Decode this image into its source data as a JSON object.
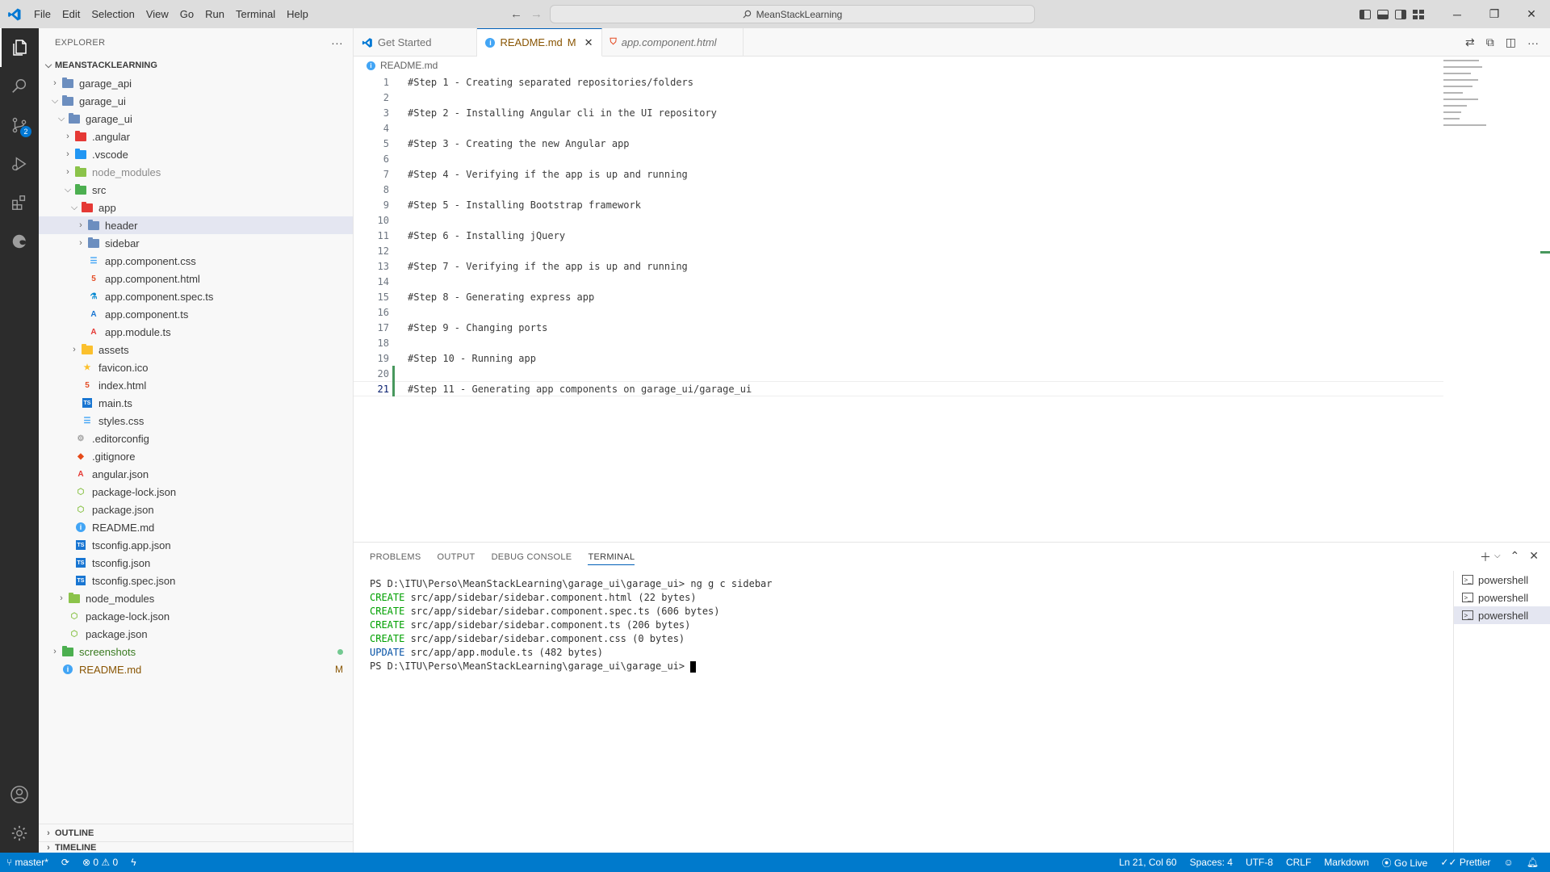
{
  "titlebar": {
    "menu": [
      "File",
      "Edit",
      "Selection",
      "View",
      "Go",
      "Run",
      "Terminal",
      "Help"
    ],
    "search_text": "MeanStackLearning"
  },
  "activity": {
    "scm_badge": "2"
  },
  "explorer": {
    "title": "EXPLORER",
    "root": "MEANSTACKLEARNING",
    "items": [
      {
        "label": "garage_api",
        "depth": 1,
        "kind": "folder",
        "open": false,
        "color": "#6c8ebf"
      },
      {
        "label": "garage_ui",
        "depth": 1,
        "kind": "folder",
        "open": true,
        "color": "#6c8ebf"
      },
      {
        "label": "garage_ui",
        "depth": 2,
        "kind": "folder",
        "open": true,
        "color": "#6c8ebf"
      },
      {
        "label": ".angular",
        "depth": 3,
        "kind": "folder",
        "open": false,
        "color": "#e53935"
      },
      {
        "label": ".vscode",
        "depth": 3,
        "kind": "folder",
        "open": false,
        "color": "#2196f3"
      },
      {
        "label": "node_modules",
        "depth": 3,
        "kind": "folder",
        "open": false,
        "color": "#8bc34a",
        "dim": true
      },
      {
        "label": "src",
        "depth": 3,
        "kind": "folder",
        "open": true,
        "color": "#4caf50"
      },
      {
        "label": "app",
        "depth": 4,
        "kind": "folder",
        "open": true,
        "color": "#e53935"
      },
      {
        "label": "header",
        "depth": 5,
        "kind": "folder",
        "open": false,
        "color": "#6c8ebf",
        "selected": true
      },
      {
        "label": "sidebar",
        "depth": 5,
        "kind": "folder",
        "open": false,
        "color": "#6c8ebf"
      },
      {
        "label": "app.component.css",
        "depth": 5,
        "kind": "file",
        "icon": "css-file-icon",
        "glyph": "☰",
        "color": "#42a5f5"
      },
      {
        "label": "app.component.html",
        "depth": 5,
        "kind": "file",
        "icon": "html-file-icon",
        "glyph": "5",
        "color": "#e44d26"
      },
      {
        "label": "app.component.spec.ts",
        "depth": 5,
        "kind": "file",
        "icon": "test-file-icon",
        "glyph": "⚗",
        "color": "#0288d1"
      },
      {
        "label": "app.component.ts",
        "depth": 5,
        "kind": "file",
        "icon": "angular-component-icon",
        "glyph": "A",
        "color": "#1976d2"
      },
      {
        "label": "app.module.ts",
        "depth": 5,
        "kind": "file",
        "icon": "angular-module-icon",
        "glyph": "A",
        "color": "#e53935"
      },
      {
        "label": "assets",
        "depth": 4,
        "kind": "folder",
        "open": false,
        "color": "#fbc02d"
      },
      {
        "label": "favicon.ico",
        "depth": 4,
        "kind": "file",
        "icon": "favicon-icon",
        "glyph": "★",
        "color": "#fbc02d"
      },
      {
        "label": "index.html",
        "depth": 4,
        "kind": "file",
        "icon": "html-file-icon",
        "glyph": "5",
        "color": "#e44d26"
      },
      {
        "label": "main.ts",
        "depth": 4,
        "kind": "file",
        "icon": "ts-file-icon",
        "glyph": "TS",
        "color": "#1976d2"
      },
      {
        "label": "styles.css",
        "depth": 4,
        "kind": "file",
        "icon": "css-file-icon",
        "glyph": "☰",
        "color": "#42a5f5"
      },
      {
        "label": ".editorconfig",
        "depth": 3,
        "kind": "file",
        "icon": "editorconfig-icon",
        "glyph": "⚙",
        "color": "#9e9e9e"
      },
      {
        "label": ".gitignore",
        "depth": 3,
        "kind": "file",
        "icon": "git-icon",
        "glyph": "◆",
        "color": "#e64a19"
      },
      {
        "label": "angular.json",
        "depth": 3,
        "kind": "file",
        "icon": "angular-icon",
        "glyph": "A",
        "color": "#e53935"
      },
      {
        "label": "package-lock.json",
        "depth": 3,
        "kind": "file",
        "icon": "npm-icon",
        "glyph": "⬡",
        "color": "#8bc34a"
      },
      {
        "label": "package.json",
        "depth": 3,
        "kind": "file",
        "icon": "npm-icon",
        "glyph": "⬡",
        "color": "#8bc34a"
      },
      {
        "label": "README.md",
        "depth": 3,
        "kind": "file",
        "icon": "info-icon",
        "glyph": "i",
        "color": "#42a5f5"
      },
      {
        "label": "tsconfig.app.json",
        "depth": 3,
        "kind": "file",
        "icon": "tsconfig-icon",
        "glyph": "TS",
        "color": "#1976d2"
      },
      {
        "label": "tsconfig.json",
        "depth": 3,
        "kind": "file",
        "icon": "tsconfig-icon",
        "glyph": "TS",
        "color": "#1976d2"
      },
      {
        "label": "tsconfig.spec.json",
        "depth": 3,
        "kind": "file",
        "icon": "tsconfig-icon",
        "glyph": "TS",
        "color": "#1976d2"
      },
      {
        "label": "node_modules",
        "depth": 2,
        "kind": "folder",
        "open": false,
        "color": "#8bc34a"
      },
      {
        "label": "package-lock.json",
        "depth": 2,
        "kind": "file",
        "icon": "npm-icon",
        "glyph": "⬡",
        "color": "#8bc34a"
      },
      {
        "label": "package.json",
        "depth": 2,
        "kind": "file",
        "icon": "npm-icon",
        "glyph": "⬡",
        "color": "#8bc34a"
      },
      {
        "label": "screenshots",
        "depth": 1,
        "kind": "folder",
        "open": false,
        "color": "#4caf50",
        "status": "green",
        "dot": true
      },
      {
        "label": "README.md",
        "depth": 1,
        "kind": "file",
        "icon": "info-icon",
        "glyph": "i",
        "color": "#42a5f5",
        "status": "modified",
        "decoration": "M"
      }
    ],
    "outline": "OUTLINE",
    "timeline": "TIMELINE"
  },
  "editor": {
    "tabs": [
      {
        "label": "Get Started",
        "icon": "vscode-icon",
        "active": false
      },
      {
        "label": "README.md",
        "flag": "M",
        "icon": "info-icon",
        "active": true
      },
      {
        "label": "app.component.html",
        "icon": "html-file-icon",
        "active": false,
        "italic": true
      }
    ],
    "breadcrumb": "README.md",
    "lines": [
      "#Step 1 - Creating separated repositories/folders",
      "",
      "#Step 2 - Installing Angular cli in the UI repository",
      "",
      "#Step 3 - Creating the new Angular app",
      "",
      "#Step 4 - Verifying if the app is up and running",
      "",
      "#Step 5 - Installing Bootstrap framework",
      "",
      "#Step 6 - Installing jQuery",
      "",
      "#Step 7 - Verifying if the app is up and running",
      "",
      "#Step 8 - Generating express app",
      "",
      "#Step 9 - Changing ports",
      "",
      "#Step 10 - Running app",
      "",
      "#Step 11 - Generating app components on garage_ui/garage_ui"
    ],
    "current_line": 21
  },
  "panel": {
    "tabs": [
      "PROBLEMS",
      "OUTPUT",
      "DEBUG CONSOLE",
      "TERMINAL"
    ],
    "active_tab": "TERMINAL",
    "terminal": [
      {
        "prefix": "PS D:\\ITU\\Perso\\MeanStackLearning\\garage_ui\\garage_ui> ",
        "text": "ng g c sidebar",
        "type": "prompt"
      },
      {
        "prefix": "CREATE",
        "text": " src/app/sidebar/sidebar.component.html (22 bytes)",
        "type": "create"
      },
      {
        "prefix": "CREATE",
        "text": " src/app/sidebar/sidebar.component.spec.ts (606 bytes)",
        "type": "create"
      },
      {
        "prefix": "CREATE",
        "text": " src/app/sidebar/sidebar.component.ts (206 bytes)",
        "type": "create"
      },
      {
        "prefix": "CREATE",
        "text": " src/app/sidebar/sidebar.component.css (0 bytes)",
        "type": "create"
      },
      {
        "prefix": "UPDATE",
        "text": " src/app/app.module.ts (482 bytes)",
        "type": "update"
      },
      {
        "prefix": "PS D:\\ITU\\Perso\\MeanStackLearning\\garage_ui\\garage_ui> ",
        "text": "",
        "type": "prompt",
        "cursor": true
      }
    ],
    "terminals": [
      "powershell",
      "powershell",
      "powershell"
    ],
    "active_terminal": 2
  },
  "statusbar": {
    "branch": "master*",
    "errors": "0",
    "warnings": "0",
    "position": "Ln 21, Col 60",
    "spaces": "Spaces: 4",
    "encoding": "UTF-8",
    "eol": "CRLF",
    "language": "Markdown",
    "golive": "Go Live",
    "prettier": "Prettier"
  },
  "colors": {
    "accent": "#007acc",
    "tab_accent": "#005fb8",
    "modified": "#895503",
    "added": "#48985d"
  }
}
